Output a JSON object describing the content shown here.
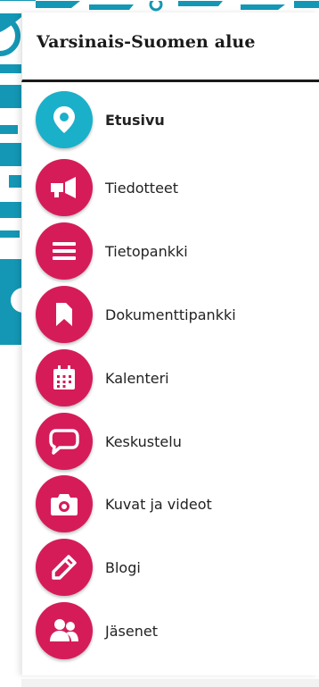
{
  "header": {
    "title": "Varsinais-Suomen alue"
  },
  "colors": {
    "home": "#1ab0c9",
    "accent": "#d51c59",
    "background_pattern": "#1497b5"
  },
  "menu": {
    "items": [
      {
        "label": "Etusivu",
        "icon": "location-pin-icon",
        "active": true
      },
      {
        "label": "Tiedotteet",
        "icon": "megaphone-icon",
        "active": false
      },
      {
        "label": "Tietopankki",
        "icon": "list-icon",
        "active": false
      },
      {
        "label": "Dokumenttipankki",
        "icon": "bookmark-icon",
        "active": false
      },
      {
        "label": "Kalenteri",
        "icon": "calendar-icon",
        "active": false
      },
      {
        "label": "Keskustelu",
        "icon": "speech-bubble-icon",
        "active": false
      },
      {
        "label": "Kuvat ja videot",
        "icon": "camera-icon",
        "active": false
      },
      {
        "label": "Blogi",
        "icon": "pencil-icon",
        "active": false
      },
      {
        "label": "Jäsenet",
        "icon": "members-icon",
        "active": false
      }
    ]
  }
}
